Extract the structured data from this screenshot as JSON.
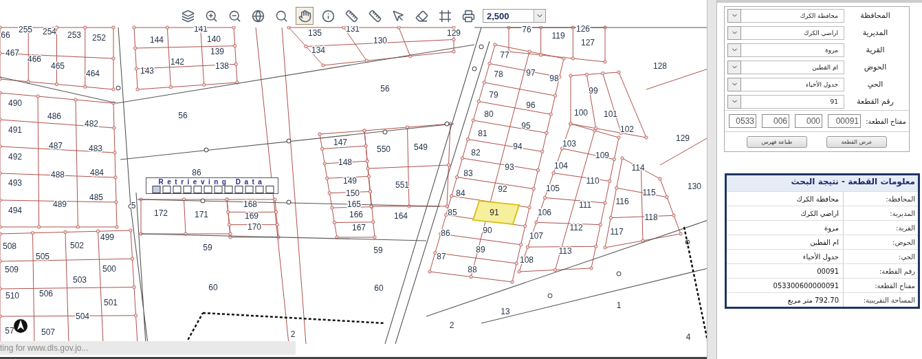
{
  "toolbar": {
    "tools": [
      {
        "kind": "legend",
        "selected": false
      },
      {
        "kind": "zoom-in",
        "selected": false
      },
      {
        "kind": "zoom-out",
        "selected": false
      },
      {
        "kind": "full-extent",
        "selected": false
      },
      {
        "kind": "zoom-select",
        "selected": false
      },
      {
        "kind": "pan",
        "selected": true
      },
      {
        "kind": "identify",
        "selected": false
      },
      {
        "kind": "measure",
        "selected": false
      },
      {
        "kind": "measure-area",
        "selected": false
      },
      {
        "kind": "select-parcel",
        "selected": false
      },
      {
        "kind": "erase",
        "selected": false
      },
      {
        "kind": "frame",
        "selected": false
      },
      {
        "kind": "print",
        "selected": false
      }
    ],
    "scale": "2,500"
  },
  "map": {
    "parcels": [
      "255",
      "254",
      "253",
      "252",
      "66",
      "467",
      "466",
      "465",
      "464",
      "490",
      "486",
      "482",
      "491",
      "487",
      "483",
      "492",
      "488",
      "484",
      "493",
      "489",
      "485",
      "494",
      "508",
      "505",
      "502",
      "499",
      "509",
      "503",
      "500",
      "510",
      "506",
      "501",
      "504",
      "57",
      "507",
      "141",
      "144",
      "140",
      "139",
      "142",
      "143",
      "138",
      "135",
      "131",
      "130",
      "129",
      "134",
      "56",
      "56",
      "86",
      "172",
      "171",
      "59",
      "60",
      "168",
      "169",
      "170",
      "147",
      "148",
      "149",
      "150",
      "165",
      "166",
      "167",
      "550",
      "549",
      "551",
      "164",
      "59",
      "60",
      "2",
      "2",
      "76",
      "119",
      "126",
      "127",
      "128",
      "77",
      "78",
      "97",
      "98",
      "79",
      "96",
      "99",
      "80",
      "95",
      "100",
      "101",
      "102",
      "81",
      "94",
      "103",
      "129",
      "82",
      "93",
      "104",
      "109",
      "114",
      "83",
      "92",
      "105",
      "110",
      "115",
      "130",
      "84",
      "111",
      "116",
      "85",
      "106",
      "118",
      "86",
      "90",
      "107",
      "112",
      "117",
      "87",
      "89",
      "108",
      "113",
      "88",
      "1",
      "4",
      "13",
      "5"
    ],
    "highlighted_parcel": {
      "label": "91"
    },
    "loading_text": "Retrieving Data",
    "status": "ting for www.dls.gov.jo..."
  },
  "search_form": {
    "fields": [
      {
        "label": "المحافظة",
        "value": "محافظة الكرك"
      },
      {
        "label": "المديرية",
        "value": "اراضي الكرك"
      },
      {
        "label": "القرية",
        "value": "مروة"
      },
      {
        "label": "الحوض",
        "value": "ام القطين"
      },
      {
        "label": "الحي",
        "value": "جدول الأحياء"
      },
      {
        "label": "رقم القطعة",
        "value": "91"
      }
    ],
    "key_label": "مفتاح القطعة:",
    "key_parts": [
      "0533",
      "006",
      "000",
      "00091"
    ],
    "buttons": [
      "عرض القطعة",
      "طباعة فهرس"
    ]
  },
  "result": {
    "title": "معلومات القطعة - نتيجة البحث",
    "rows": [
      {
        "label": "المحافظة:",
        "value": "محافظة الكرك"
      },
      {
        "label": "المديرية:",
        "value": "اراضي الكرك"
      },
      {
        "label": "القرية:",
        "value": "مروة"
      },
      {
        "label": "الحوض:",
        "value": "ام القطين"
      },
      {
        "label": "الحي:",
        "value": "جدول الأحياء"
      },
      {
        "label": "رقم القطعة:",
        "value": "00091"
      },
      {
        "label": "مفتاح القطعة:",
        "value": "053300600000091"
      },
      {
        "label": "المساحة التقريبية:",
        "value": "792.70 متر مربع"
      }
    ]
  }
}
